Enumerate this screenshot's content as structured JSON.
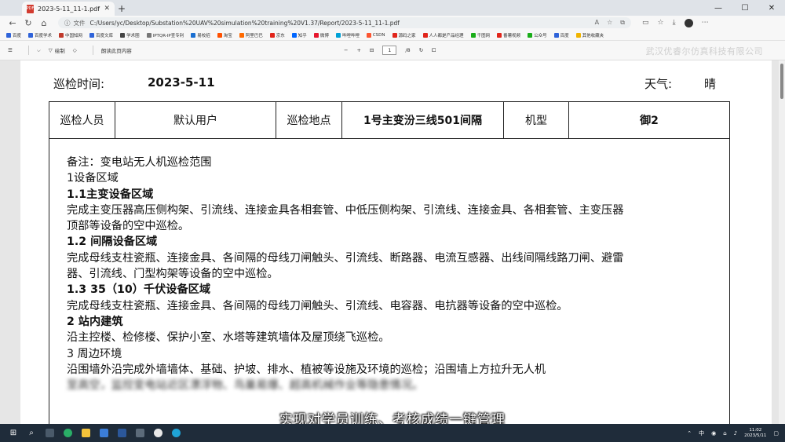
{
  "browser": {
    "tab_title": "2023-5-11_11-1.pdf",
    "tab_icon": "PDF",
    "address_label": "文件",
    "url": "C:/Users/yc/Desktop/Substation%20UAV%20simulation%20training%20V1.37/Report/2023-5-11_11-1.pdf",
    "bookmarks": [
      {
        "label": "百度",
        "color": "#2f63d9"
      },
      {
        "label": "百度学术",
        "color": "#2f63d9"
      },
      {
        "label": "中国知网",
        "color": "#c0392b"
      },
      {
        "label": "百度文库",
        "color": "#2f63d9"
      },
      {
        "label": "学术圈",
        "color": "#444444"
      },
      {
        "label": "IPTQR-IP查专利",
        "color": "#777777"
      },
      {
        "label": "易校招",
        "color": "#1a6fd1"
      },
      {
        "label": "淘宝",
        "color": "#ff5000"
      },
      {
        "label": "阿里巴巴",
        "color": "#ff6a00"
      },
      {
        "label": "京东",
        "color": "#e1251b"
      },
      {
        "label": "知乎",
        "color": "#0066ff"
      },
      {
        "label": "微博",
        "color": "#e6162d"
      },
      {
        "label": "哔哩哔哩",
        "color": "#00a1d6"
      },
      {
        "label": "CSDN",
        "color": "#fc5531"
      },
      {
        "label": "源码之家",
        "color": "#e1251b"
      },
      {
        "label": "人人都是产品经理",
        "color": "#e1251b"
      },
      {
        "label": "千图网",
        "color": "#1aad19"
      },
      {
        "label": "番薯视频",
        "color": "#e1251b"
      },
      {
        "label": "公众号",
        "color": "#1aad19"
      },
      {
        "label": "百度",
        "color": "#2f63d9"
      },
      {
        "label": "其他收藏夹",
        "color": "#f0b400"
      }
    ]
  },
  "pdf_toolbar": {
    "draw_label": "绘制",
    "read_aloud_label": "朗读此页内容",
    "current_page": "1",
    "total_pages": "/8"
  },
  "watermark": "武汉优睿尔仿真科技有限公司",
  "report": {
    "inspection_time_label": "巡检时间:",
    "inspection_date": "2023-5-11",
    "weather_label": "天气:",
    "weather_value": "晴",
    "info_row": [
      "巡检人员",
      "默认用户",
      "巡检地点",
      "1号主变汾三线501间隔",
      "机型",
      "御2"
    ],
    "notes": [
      "备注：变电站无人机巡检范围",
      "1设备区域",
      "1.1主变设备区域",
      "完成主变压器高压侧构架、引流线、连接金具各相套管、中低压侧构架、引流线、连接金具、各相套管、主变压器",
      "顶部等设备的空中巡检。",
      "1.2 间隔设备区域",
      "完成母线支柱瓷瓶、连接金具、各间隔的母线刀闸触头、引流线、断路器、电流互感器、出线间隔线路刀闸、避雷",
      "器、引流线、门型构架等设备的空中巡检。",
      "1.3 35（10）千伏设备区域",
      "完成母线支柱瓷瓶、连接金具、各间隔的母线刀闸触头、引流线、电容器、电抗器等设备的空中巡检。",
      "2 站内建筑",
      "沿主控楼、检修楼、保护小室、水塔等建筑墙体及屋顶绕飞巡检。",
      "3 周边环境",
      "沿围墙外沿完成外墙墙体、基础、护坡、排水、植被等设施及环境的巡检；沿围墙上方拉升无人机",
      "至高空，监控变电站近区漂浮物、鸟巢易爆、超高机械作业等隐患情况。"
    ]
  },
  "subtitle": "实现对学员训练、考核成绩一键管理",
  "taskbar": {
    "ime": "中",
    "time": "11:02",
    "date": "2023/5/11"
  }
}
